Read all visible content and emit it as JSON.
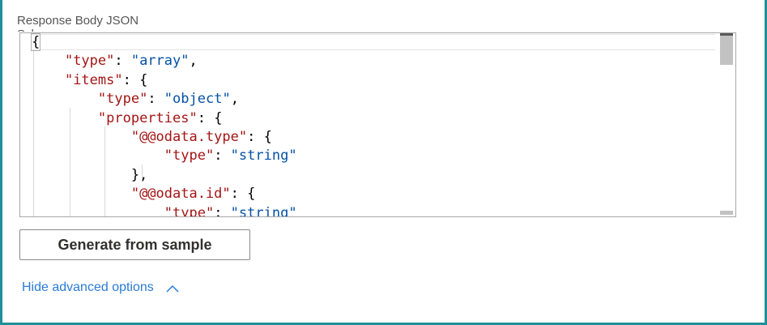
{
  "schema_field": {
    "label": "Response Body JSON Schema",
    "code_lines": [
      [
        {
          "t": "p",
          "v": "{"
        }
      ],
      [
        {
          "t": "p",
          "v": "    "
        },
        {
          "t": "k",
          "v": "\"type\""
        },
        {
          "t": "p",
          "v": ": "
        },
        {
          "t": "s",
          "v": "\"array\""
        },
        {
          "t": "p",
          "v": ","
        }
      ],
      [
        {
          "t": "p",
          "v": "    "
        },
        {
          "t": "k",
          "v": "\"items\""
        },
        {
          "t": "p",
          "v": ": {"
        }
      ],
      [
        {
          "t": "p",
          "v": "        "
        },
        {
          "t": "k",
          "v": "\"type\""
        },
        {
          "t": "p",
          "v": ": "
        },
        {
          "t": "s",
          "v": "\"object\""
        },
        {
          "t": "p",
          "v": ","
        }
      ],
      [
        {
          "t": "p",
          "v": "        "
        },
        {
          "t": "k",
          "v": "\"properties\""
        },
        {
          "t": "p",
          "v": ": {"
        }
      ],
      [
        {
          "t": "p",
          "v": "            "
        },
        {
          "t": "k",
          "v": "\"@@odata.type\""
        },
        {
          "t": "p",
          "v": ": {"
        }
      ],
      [
        {
          "t": "p",
          "v": "                "
        },
        {
          "t": "k",
          "v": "\"type\""
        },
        {
          "t": "p",
          "v": ": "
        },
        {
          "t": "s",
          "v": "\"string\""
        }
      ],
      [
        {
          "t": "p",
          "v": "            },"
        }
      ],
      [
        {
          "t": "p",
          "v": "            "
        },
        {
          "t": "k",
          "v": "\"@@odata.id\""
        },
        {
          "t": "p",
          "v": ": {"
        }
      ],
      [
        {
          "t": "p",
          "v": "                "
        },
        {
          "t": "k",
          "v": "\"type\""
        },
        {
          "t": "p",
          "v": ": "
        },
        {
          "t": "s",
          "v": "\"string\""
        }
      ]
    ]
  },
  "actions": {
    "generate_label": "Generate from sample",
    "advanced_label": "Hide advanced options",
    "advanced_icon": "chevron-up-icon"
  },
  "colors": {
    "frame_border": "#1f8f99",
    "json_key": "#a31515",
    "json_string": "#0451a5",
    "link": "#2b7bd6"
  }
}
